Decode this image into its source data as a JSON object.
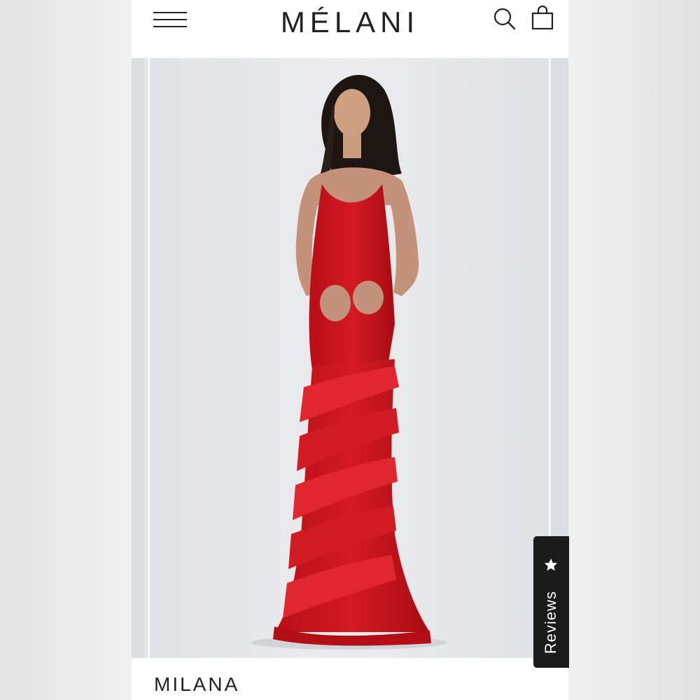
{
  "header": {
    "brand": "MÉLANI",
    "menu_icon": "hamburger-menu-icon",
    "search_icon": "search-icon",
    "bag_icon": "shopping-bag-icon"
  },
  "product": {
    "name": "MILANA"
  },
  "reviews_tab": {
    "label": "Reviews",
    "icon": "star-icon"
  },
  "colors": {
    "dress": "#c8141c",
    "tab_background": "#1b1b1b",
    "text": "#222222"
  }
}
